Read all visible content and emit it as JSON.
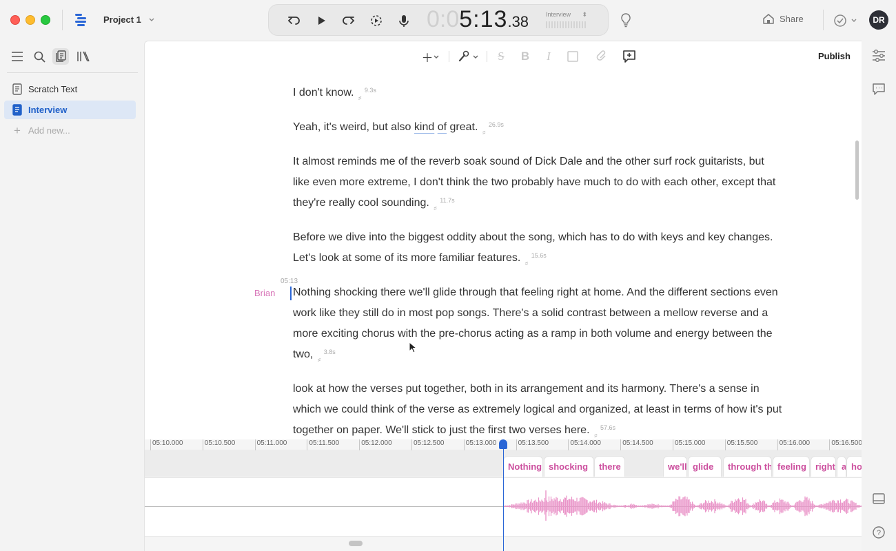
{
  "titlebar": {
    "project_title": "Project 1",
    "share_label": "Share",
    "avatar_initials": "DR"
  },
  "transport": {
    "timecode_dim": "0:0",
    "timecode_main": "5:13",
    "timecode_frac": ".38",
    "document_name": "Interview"
  },
  "sidebar": {
    "items": [
      {
        "label": "Scratch Text"
      },
      {
        "label": "Interview"
      },
      {
        "label": "Add new..."
      }
    ]
  },
  "toolbar": {
    "publish_label": "Publish"
  },
  "document": {
    "p1": {
      "text": "I don't know.",
      "gap": "9.3s"
    },
    "p2": {
      "before": "Yeah, it's weird, but also ",
      "u1": "kind",
      "mid": " ",
      "u2": "of",
      "after": " great.",
      "gap": "26.9s"
    },
    "p3": {
      "text": "It almost reminds me of the reverb soak sound of Dick Dale and the other surf rock guitarists, but like even more extreme, I don't think the two probably have much to do with each other, except that they're really cool sounding.",
      "gap": "11.7s"
    },
    "p4": {
      "text": "Before we dive into the biggest oddity about the song, which has to do with keys and key changes. Let's look at some of its more familiar features.",
      "gap": "15.6s"
    },
    "p5": {
      "speaker": "Brian",
      "timestamp": "05:13",
      "text": "Nothing shocking there we'll glide through that feeling right at home. And the different sections even work like they still do in most pop songs. There's a solid contrast between a mellow reverse and a more exciting chorus with the pre-chorus acting as a ramp in both volume and energy between the two,",
      "gap": "3.8s"
    },
    "p6": {
      "text": "look at how the verses put together, both in its arrangement and its harmony. There's a sense in which we could think of the verse as extremely logical and organized, at least in terms of how it's put together on paper. We'll stick to just the first two verses here.",
      "gap": "57.6s"
    }
  },
  "timeline": {
    "ticks": [
      "05:10.000",
      "05:10.500",
      "05:11.000",
      "05:11.500",
      "05:12.000",
      "05:12.500",
      "05:13.000",
      "05:13.500",
      "05:14.000",
      "05:14.500",
      "05:15.000",
      "05:15.500",
      "05:16.000",
      "05:16.500"
    ],
    "words": [
      "Nothing",
      "shocking",
      "there",
      "we'll",
      "glide",
      "through th",
      "feeling",
      "right",
      "a",
      "ho"
    ]
  },
  "colors": {
    "accent": "#2a66d6",
    "speaker": "#d774b7",
    "word": "#cc4f9e",
    "waveform": "#ea94c8"
  }
}
